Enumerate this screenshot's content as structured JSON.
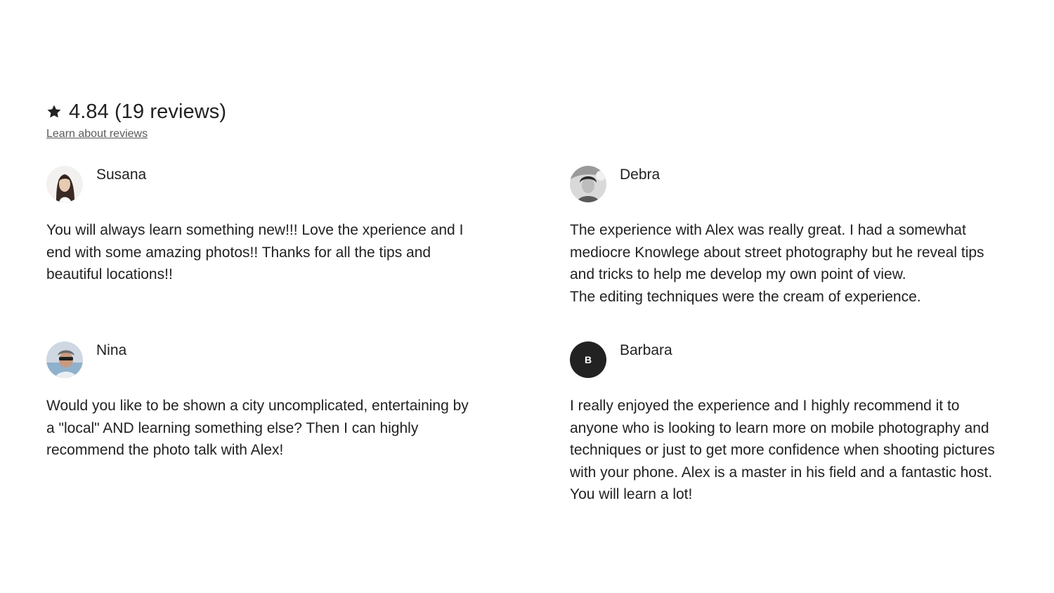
{
  "summary": {
    "rating_label": "4.84 (19 reviews)",
    "learn_link": "Learn about reviews",
    "star_icon": "star-icon"
  },
  "reviews": [
    {
      "name": "Susana",
      "avatar": "photo",
      "meta": "",
      "text": "You will always learn something new!!!  Love the xperience and I end with some amazing photos!!  Thanks for all the tips and beautiful locations!!"
    },
    {
      "name": "Debra",
      "avatar": "photo",
      "meta": "",
      "text": "The experience with Alex was really great. I had a somewhat mediocre Knowlege about street photography but he reveal tips and tricks to help me develop my own point of view.\nThe editing techniques were the cream of experience."
    },
    {
      "name": "Nina",
      "avatar": "photo",
      "meta": "",
      "text": "Would you like to be shown a city uncomplicated, entertaining by a \"local\" AND learning something else? Then I can highly recommend the photo talk with Alex!"
    },
    {
      "name": "Barbara",
      "avatar": "initial",
      "avatar_initial": "B",
      "meta": "",
      "text": "I really enjoyed the experience and I highly recommend it to anyone who is looking to learn more on mobile photography and techniques or just to get more confidence when shooting pictures with your phone. Alex is a master in his field and a fantastic host. You will learn a lot!"
    }
  ],
  "colors": {
    "text": "#222222",
    "link": "#595959",
    "avatar_initial_bg": "#222222"
  }
}
